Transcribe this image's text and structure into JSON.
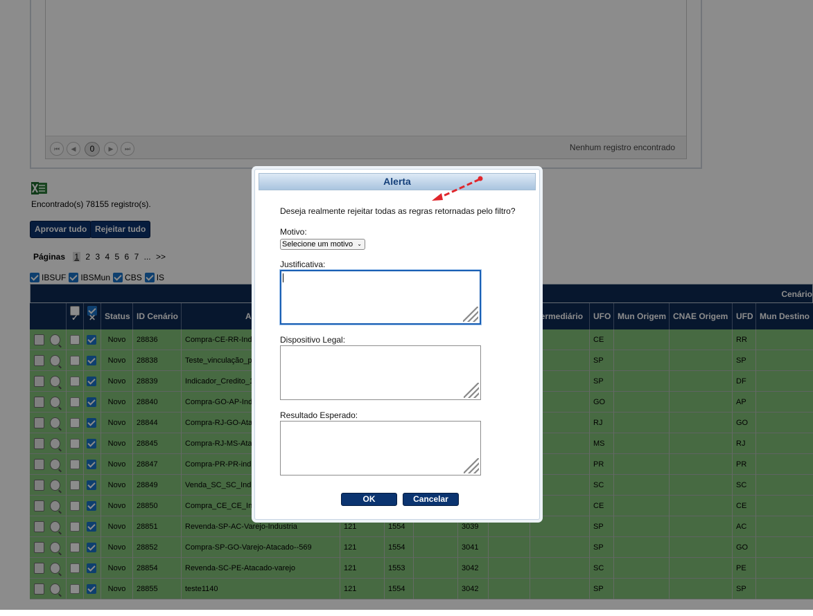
{
  "top_panel": {
    "pager_page": "0",
    "empty_message": "Nenhum registro encontrado"
  },
  "found_text": "Encontrado(s) 78155 registro(s).",
  "actions": {
    "approve_all": "Aprovar tudo",
    "reject_all": "Rejeitar tudo"
  },
  "pages": {
    "label": "Páginas",
    "items": [
      "1",
      "2",
      "3",
      "4",
      "5",
      "6",
      "7",
      "...",
      ">>"
    ]
  },
  "filters": [
    "IBSUF",
    "IBSMun",
    "CBS",
    "IS"
  ],
  "table": {
    "group_header": "Cenário",
    "columns": [
      "Status",
      "ID Cenário",
      "Ap",
      "Intermediário",
      "UFO",
      "Mun Origem",
      "CNAE Origem",
      "UFD",
      "Mun Destino"
    ],
    "rows": [
      {
        "checked": true,
        "status": "Novo",
        "id": "28836",
        "name": "Compra-CE-RR-Indus",
        "c1": "",
        "c2": "",
        "c3": "",
        "ufo": "CE",
        "ufd": "RR"
      },
      {
        "checked": true,
        "status": "Novo",
        "id": "28838",
        "name": "Teste_vinculação_pa",
        "c1": "",
        "c2": "",
        "c3": "",
        "ufo": "SP",
        "ufd": "SP"
      },
      {
        "checked": true,
        "status": "Novo",
        "id": "28839",
        "name": "Indicador_Credito_19",
        "c1": "",
        "c2": "",
        "c3": "",
        "ufo": "SP",
        "ufd": "DF"
      },
      {
        "checked": true,
        "status": "Novo",
        "id": "28840",
        "name": "Compra-GO-AP-Indus",
        "c1": "",
        "c2": "",
        "c3": "",
        "ufo": "GO",
        "ufd": "AP"
      },
      {
        "checked": true,
        "status": "Novo",
        "id": "28844",
        "name": "Compra-RJ-GO-Atacad",
        "c1": "",
        "c2": "",
        "c3": "",
        "ufo": "RJ",
        "ufd": "GO"
      },
      {
        "checked": true,
        "status": "Novo",
        "id": "28845",
        "name": "Compra-RJ-MS-Ataca",
        "c1": "",
        "c2": "",
        "c3": "",
        "ufo": "MS",
        "ufd": "RJ"
      },
      {
        "checked": true,
        "status": "Novo",
        "id": "28847",
        "name": "Compra-PR-PR-indust",
        "c1": "",
        "c2": "",
        "c3": "",
        "ufo": "PR",
        "ufd": "PR"
      },
      {
        "checked": true,
        "status": "Novo",
        "id": "28849",
        "name": "Venda_SC_SC_Indus",
        "c1": "",
        "c2": "",
        "c3": "",
        "ufo": "SC",
        "ufd": "SC"
      },
      {
        "checked": true,
        "status": "Novo",
        "id": "28850",
        "name": "Compra_CE_CE_Indu",
        "c1": "",
        "c2": "",
        "c3": "",
        "ufo": "CE",
        "ufd": "CE"
      },
      {
        "checked": true,
        "status": "Novo",
        "id": "28851",
        "name": "Revenda-SP-AC-Varejo-Industria",
        "c1": "121",
        "c2": "1554",
        "c3": "3039",
        "ufo": "SP",
        "ufd": "AC"
      },
      {
        "checked": true,
        "status": "Novo",
        "id": "28852",
        "name": "Compra-SP-GO-Varejo-Atacado--569",
        "c1": "121",
        "c2": "1554",
        "c3": "3041",
        "ufo": "SP",
        "ufd": "GO"
      },
      {
        "checked": true,
        "status": "Novo",
        "id": "28854",
        "name": "Revenda-SC-PE-Atacado-varejo",
        "c1": "121",
        "c2": "1553",
        "c3": "3042",
        "ufo": "SC",
        "ufd": "PE"
      },
      {
        "checked": true,
        "status": "Novo",
        "id": "28855",
        "name": "teste1140",
        "c1": "121",
        "c2": "1554",
        "c3": "3042",
        "ufo": "SP",
        "ufd": "SP"
      }
    ]
  },
  "modal": {
    "title": "Alerta",
    "message": "Deseja realmente rejeitar todas as regras retornadas pelo filtro?",
    "motivo_label": "Motivo:",
    "motivo_value": "Selecione um motivo",
    "justificativa_label": "Justificativa:",
    "dispositivo_label": "Dispositivo Legal:",
    "resultado_label": "Resultado Esperado:",
    "ok": "OK",
    "cancel": "Cancelar"
  },
  "colors": {
    "header_navy": "#0e2a55",
    "row_green": "#82c278",
    "button_navy": "#0b3470",
    "arrow_red": "#e0262c"
  }
}
